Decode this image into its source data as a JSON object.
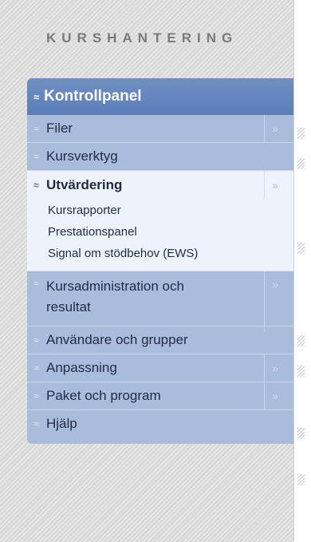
{
  "section_title": "KURSHANTERING",
  "menu": {
    "header": "Kontrollpanel",
    "items": [
      {
        "label": "Filer",
        "expander": true
      },
      {
        "label": "Kursverktyg",
        "expander": false
      },
      {
        "label": "Utvärdering",
        "expander": true,
        "active": true,
        "subitems": [
          "Kursrapporter",
          "Prestationspanel",
          "Signal om stödbehov (EWS)"
        ]
      },
      {
        "label": "Kursadministration och resultat",
        "expander": true
      },
      {
        "label": "Användare och grupper",
        "expander": false
      },
      {
        "label": "Anpassning",
        "expander": true
      },
      {
        "label": "Paket och program",
        "expander": true
      },
      {
        "label": "Hjälp",
        "expander": false
      }
    ]
  },
  "colors": {
    "header_bg": "#6f8ec3",
    "menu_bg": "#a9bcdc",
    "active_bg": "#eef3fb",
    "text": "#1f2c45"
  },
  "icons": {
    "collapse": "chevron-up-icon",
    "expand": "chevron-down-icon",
    "flyout": "double-chevron-right-icon"
  }
}
